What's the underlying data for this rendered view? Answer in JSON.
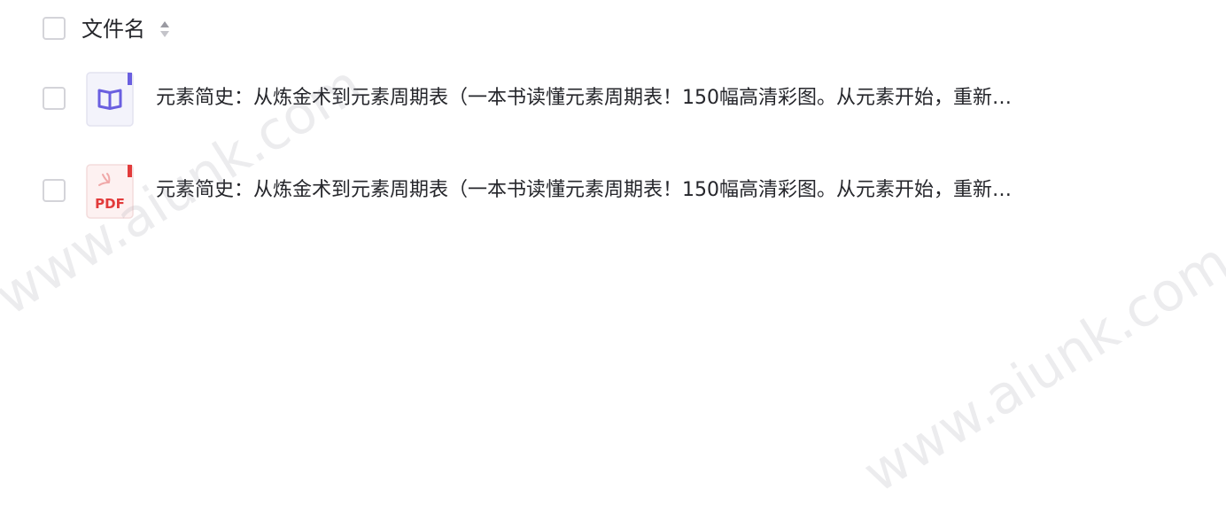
{
  "header": {
    "column_label": "文件名"
  },
  "files": [
    {
      "name": "元素简史：从炼金术到元素周期表（一本书读懂元素周期表！150幅高清彩图。从元素开始，重新…",
      "icon": "book-file-icon",
      "color": "#6a5fe0"
    },
    {
      "name": "元素简史：从炼金术到元素周期表（一本书读懂元素周期表！150幅高清彩图。从元素开始，重新…",
      "icon": "pdf-file-icon",
      "icon_label": "PDF",
      "color": "#e23b3b"
    }
  ],
  "watermarks": [
    "www.aiunk.com",
    "www.aiunk.com"
  ]
}
